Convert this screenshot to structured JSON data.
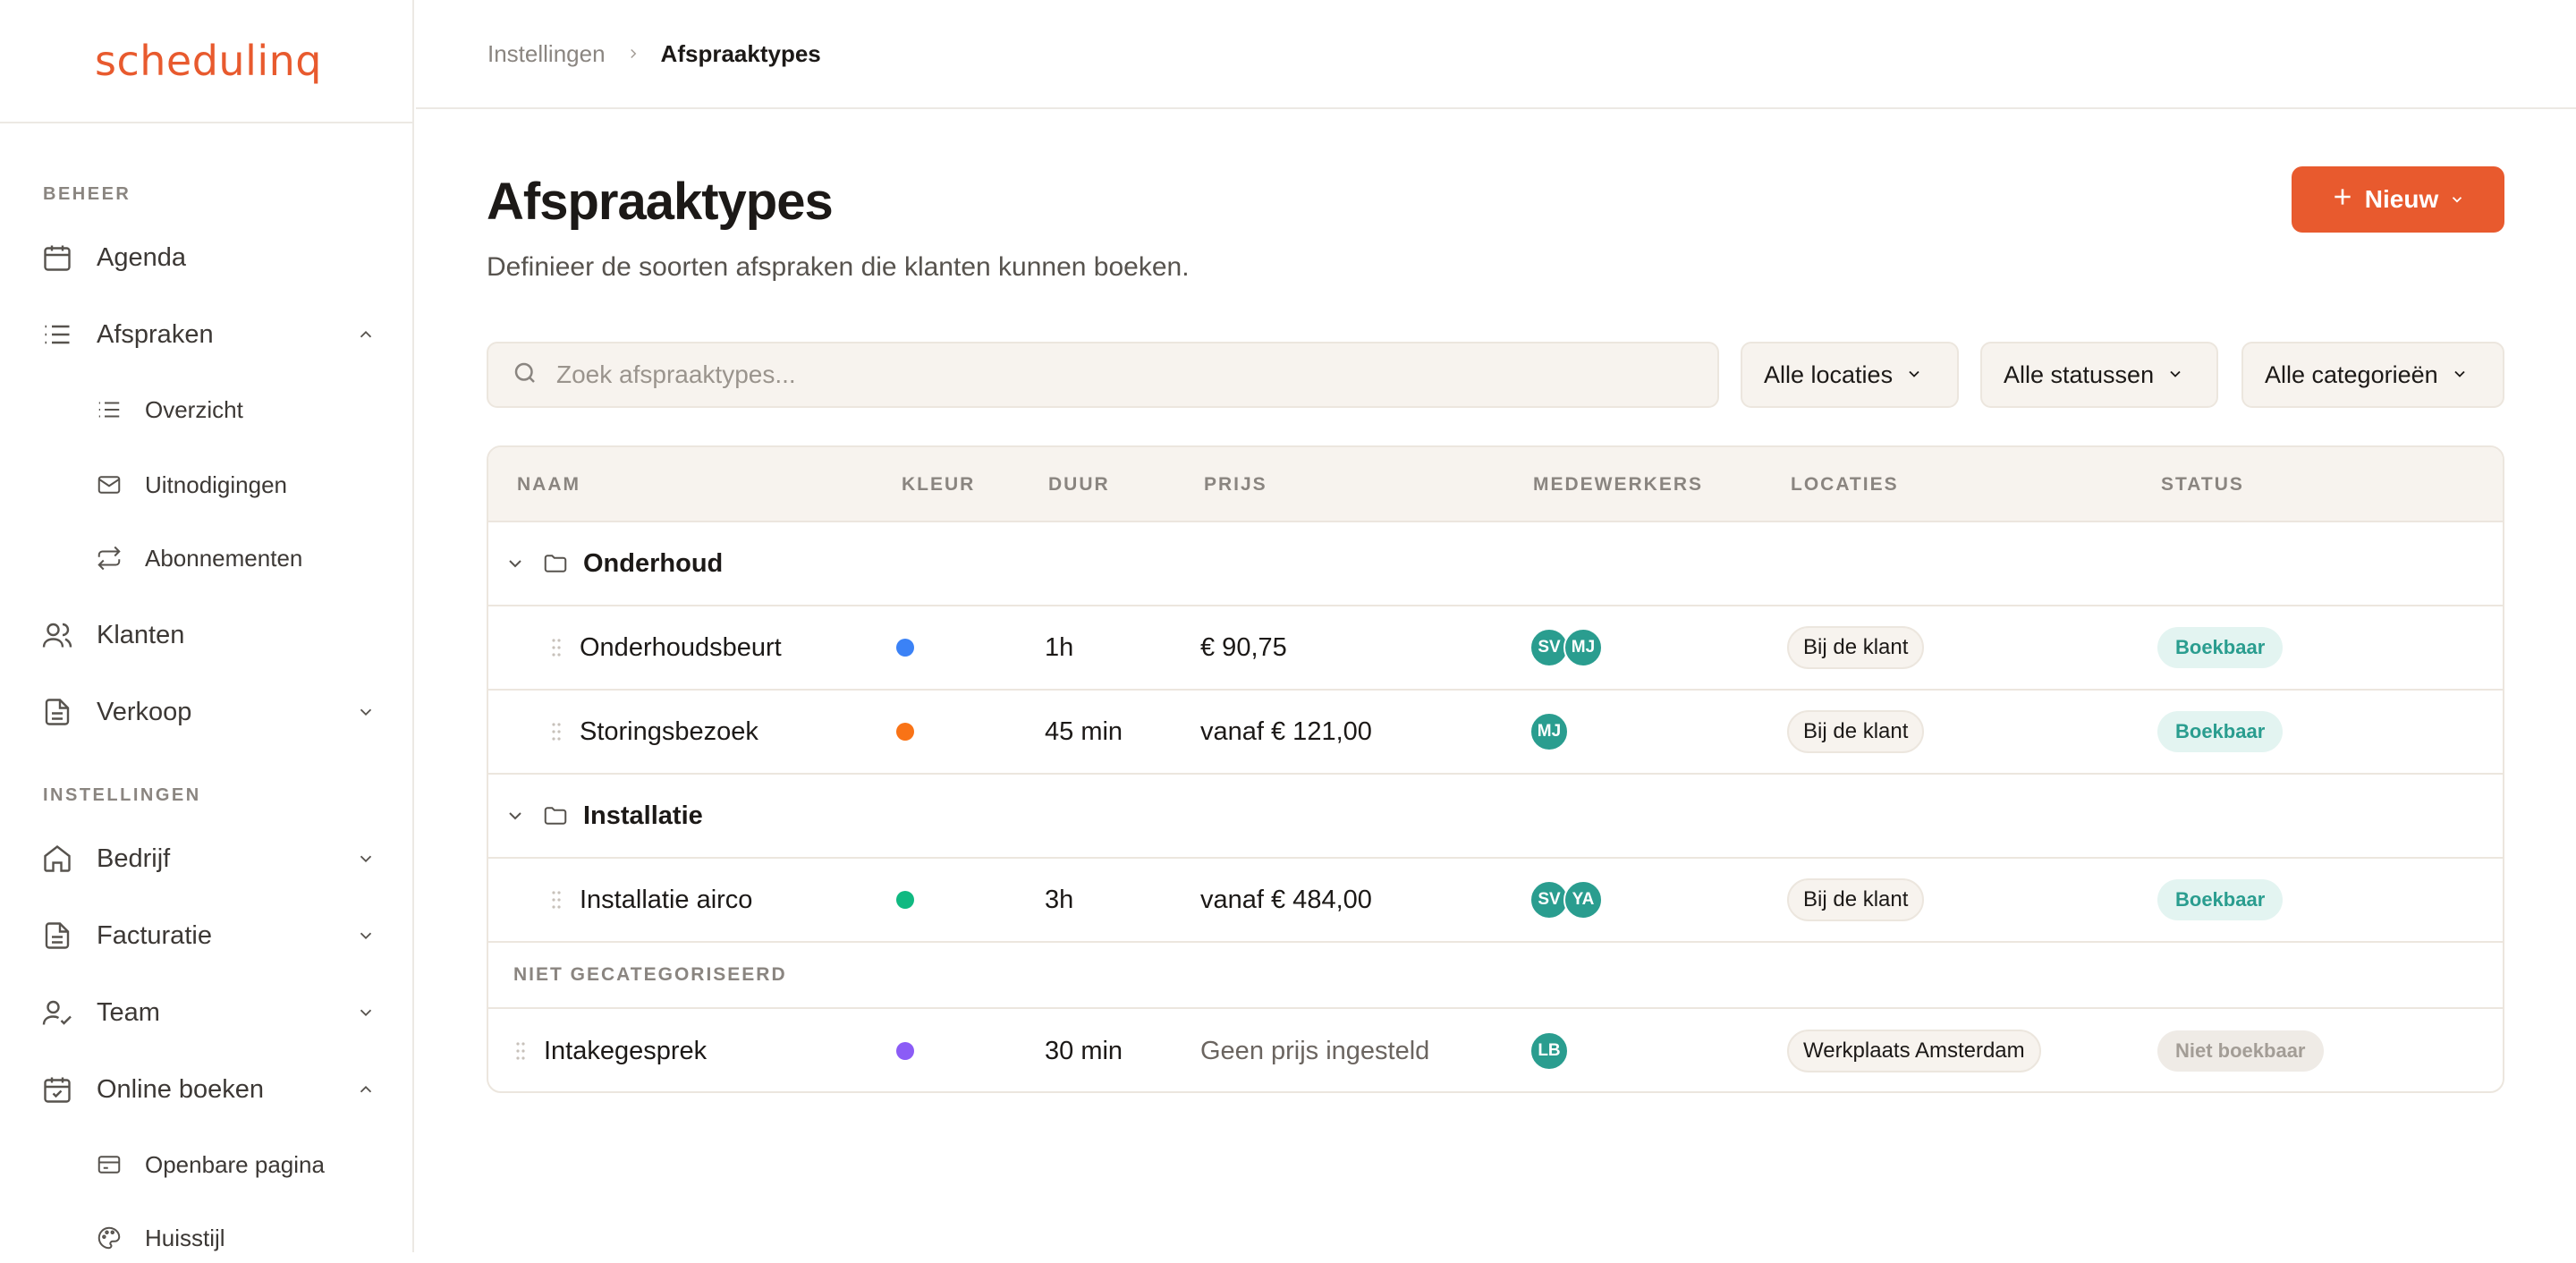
{
  "app": {
    "logo": "schedulinq",
    "accent": "#e85a2e"
  },
  "sidebar": {
    "sections": [
      {
        "label": "BEHEER"
      },
      {
        "label": "INSTELLINGEN"
      }
    ],
    "items": [
      {
        "label": "Agenda",
        "icon": "calendar-icon"
      },
      {
        "label": "Afspraken",
        "icon": "list-icon",
        "expanded": true
      },
      {
        "label": "Klanten",
        "icon": "users-icon"
      },
      {
        "label": "Verkoop",
        "icon": "document-icon",
        "expanded": false
      },
      {
        "label": "Bedrijf",
        "icon": "home-icon",
        "expanded": false
      },
      {
        "label": "Facturatie",
        "icon": "document-icon",
        "expanded": false
      },
      {
        "label": "Team",
        "icon": "user-check-icon",
        "expanded": false
      },
      {
        "label": "Online boeken",
        "icon": "calendar-check-icon",
        "expanded": true
      }
    ],
    "afspraken_sub": [
      {
        "label": "Overzicht",
        "icon": "list-icon"
      },
      {
        "label": "Uitnodigingen",
        "icon": "mail-icon"
      },
      {
        "label": "Abonnementen",
        "icon": "repeat-icon"
      }
    ],
    "online_sub": [
      {
        "label": "Openbare pagina",
        "icon": "card-icon"
      },
      {
        "label": "Huisstijl",
        "icon": "palette-icon"
      }
    ]
  },
  "breadcrumb": {
    "parent": "Instellingen",
    "current": "Afspraaktypes"
  },
  "page": {
    "title": "Afspraaktypes",
    "subtitle": "Definieer de soorten afspraken die klanten kunnen boeken.",
    "new_button": "Nieuw"
  },
  "search": {
    "placeholder": "Zoek afspraaktypes..."
  },
  "filters": {
    "locaties": "Alle locaties",
    "statussen": "Alle statussen",
    "categorieen": "Alle categorieën"
  },
  "table": {
    "headers": {
      "naam": "NAAM",
      "kleur": "KLEUR",
      "duur": "DUUR",
      "prijs": "PRIJS",
      "medewerkers": "MEDEWERKERS",
      "locaties": "LOCATIES",
      "status": "STATUS"
    },
    "groups": [
      {
        "name": "Onderhoud",
        "rows": [
          {
            "name": "Onderhoudsbeurt",
            "color": "#3b82f6",
            "duur": "1h",
            "prijs": "€ 90,75",
            "staff": [
              "SV",
              "MJ"
            ],
            "locatie": "Bij de klant",
            "status": "Boekbaar"
          },
          {
            "name": "Storingsbezoek",
            "color": "#f97316",
            "duur": "45 min",
            "prijs": "vanaf € 121,00",
            "staff": [
              "MJ"
            ],
            "locatie": "Bij de klant",
            "status": "Boekbaar"
          }
        ]
      },
      {
        "name": "Installatie",
        "rows": [
          {
            "name": "Installatie airco",
            "color": "#10b981",
            "duur": "3h",
            "prijs": "vanaf € 484,00",
            "staff": [
              "SV",
              "YA"
            ],
            "locatie": "Bij de klant",
            "status": "Boekbaar"
          }
        ]
      }
    ],
    "uncategorized_label": "NIET GECATEGORISEERD",
    "uncategorized": [
      {
        "name": "Intakegesprek",
        "color": "#8b5cf6",
        "duur": "30 min",
        "prijs": "Geen prijs ingesteld",
        "staff": [
          "LB"
        ],
        "locatie": "Werkplaats Amsterdam",
        "status": "Niet boekbaar"
      }
    ]
  }
}
